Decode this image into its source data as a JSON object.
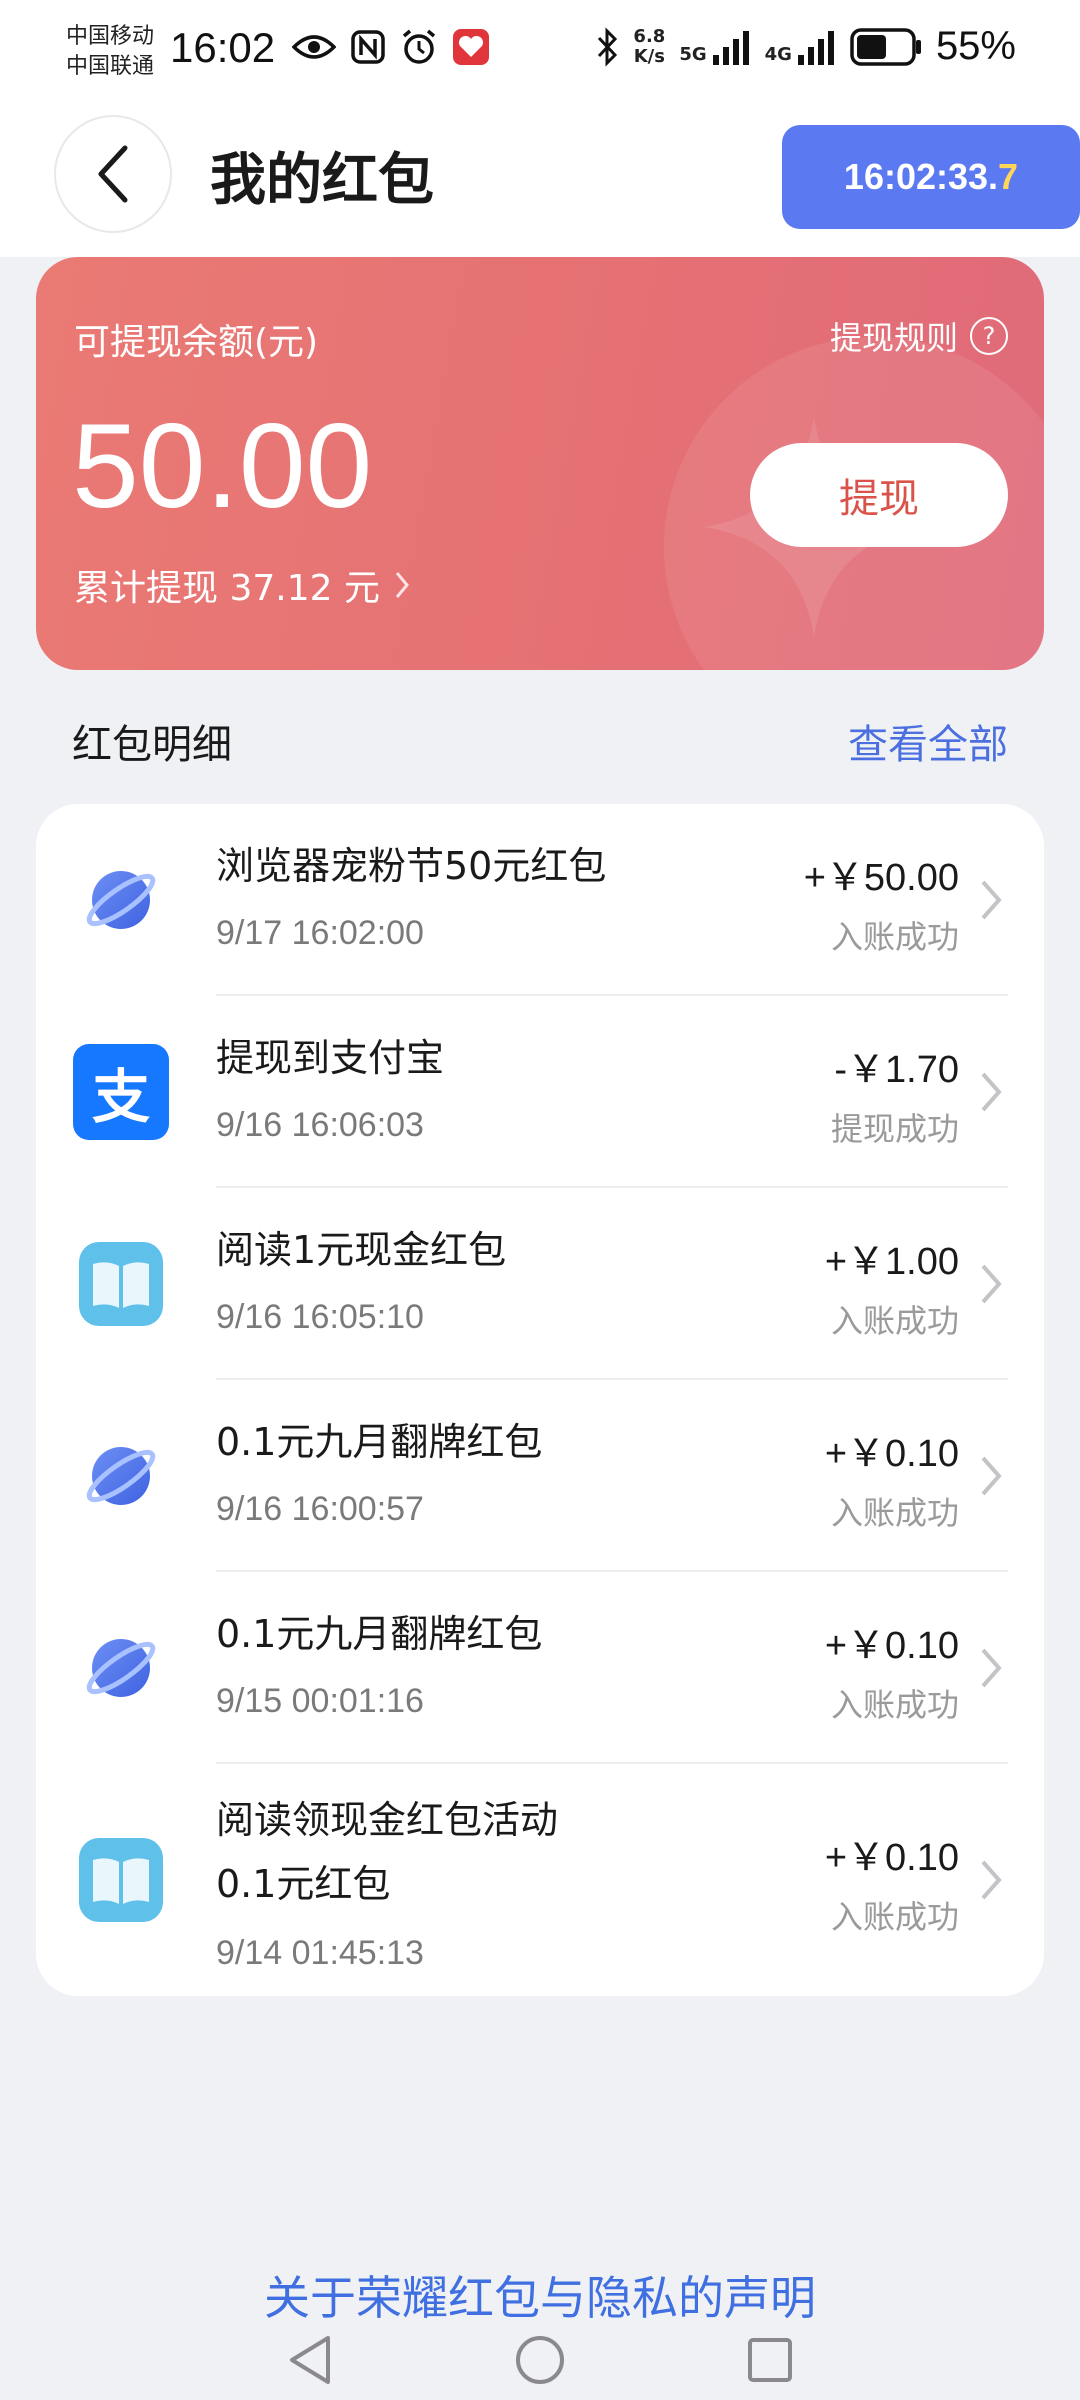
{
  "status_bar": {
    "carrier_1": "中国移动",
    "carrier_2": "中国联通",
    "time": "16:02",
    "net_speed_value": "6.8",
    "net_speed_unit": "K/s",
    "net_1": "5G",
    "net_2": "4G",
    "battery": "55%",
    "battery_level": 0.55
  },
  "header": {
    "title": "我的红包",
    "time_badge_main": "16:02:33.",
    "time_badge_ms": "7"
  },
  "balance": {
    "label": "可提现余额(元)",
    "rules_label": "提现规则",
    "rules_icon_glyph": "?",
    "amount": "50.00",
    "total_withdrawn": "累计提现 37.12 元",
    "withdraw_button": "提现"
  },
  "details": {
    "section_title": "红包明细",
    "view_all": "查看全部",
    "rows": [
      {
        "icon": "planet-icon",
        "title": "浏览器宠粉节50元红包",
        "date": "9/17 16:02:00",
        "amount": "+￥50.00",
        "status": "入账成功"
      },
      {
        "icon": "alipay-icon",
        "icon_glyph": "支",
        "title": "提现到支付宝",
        "date": "9/16 16:06:03",
        "amount": "-￥1.70",
        "status": "提现成功"
      },
      {
        "icon": "book-icon",
        "title": "阅读1元现金红包",
        "date": "9/16 16:05:10",
        "amount": "+￥1.00",
        "status": "入账成功"
      },
      {
        "icon": "planet-icon",
        "title": "0.1元九月翻牌红包",
        "date": "9/16 16:00:57",
        "amount": "+￥0.10",
        "status": "入账成功"
      },
      {
        "icon": "planet-icon",
        "title": "0.1元九月翻牌红包",
        "date": "9/15 00:01:16",
        "amount": "+￥0.10",
        "status": "入账成功"
      },
      {
        "icon": "book-icon",
        "title_line_1": "阅读领现金红包活动",
        "title_line_2": "0.1元红包",
        "date": "9/14 01:45:13",
        "amount": "+￥0.10",
        "status": "入账成功"
      }
    ]
  },
  "footer": {
    "privacy_link": "关于荣耀红包与隐私的声明"
  },
  "colors": {
    "accent_blue": "#4b6fe0",
    "card_red": "#e57174",
    "time_badge": "#5b79f1"
  }
}
